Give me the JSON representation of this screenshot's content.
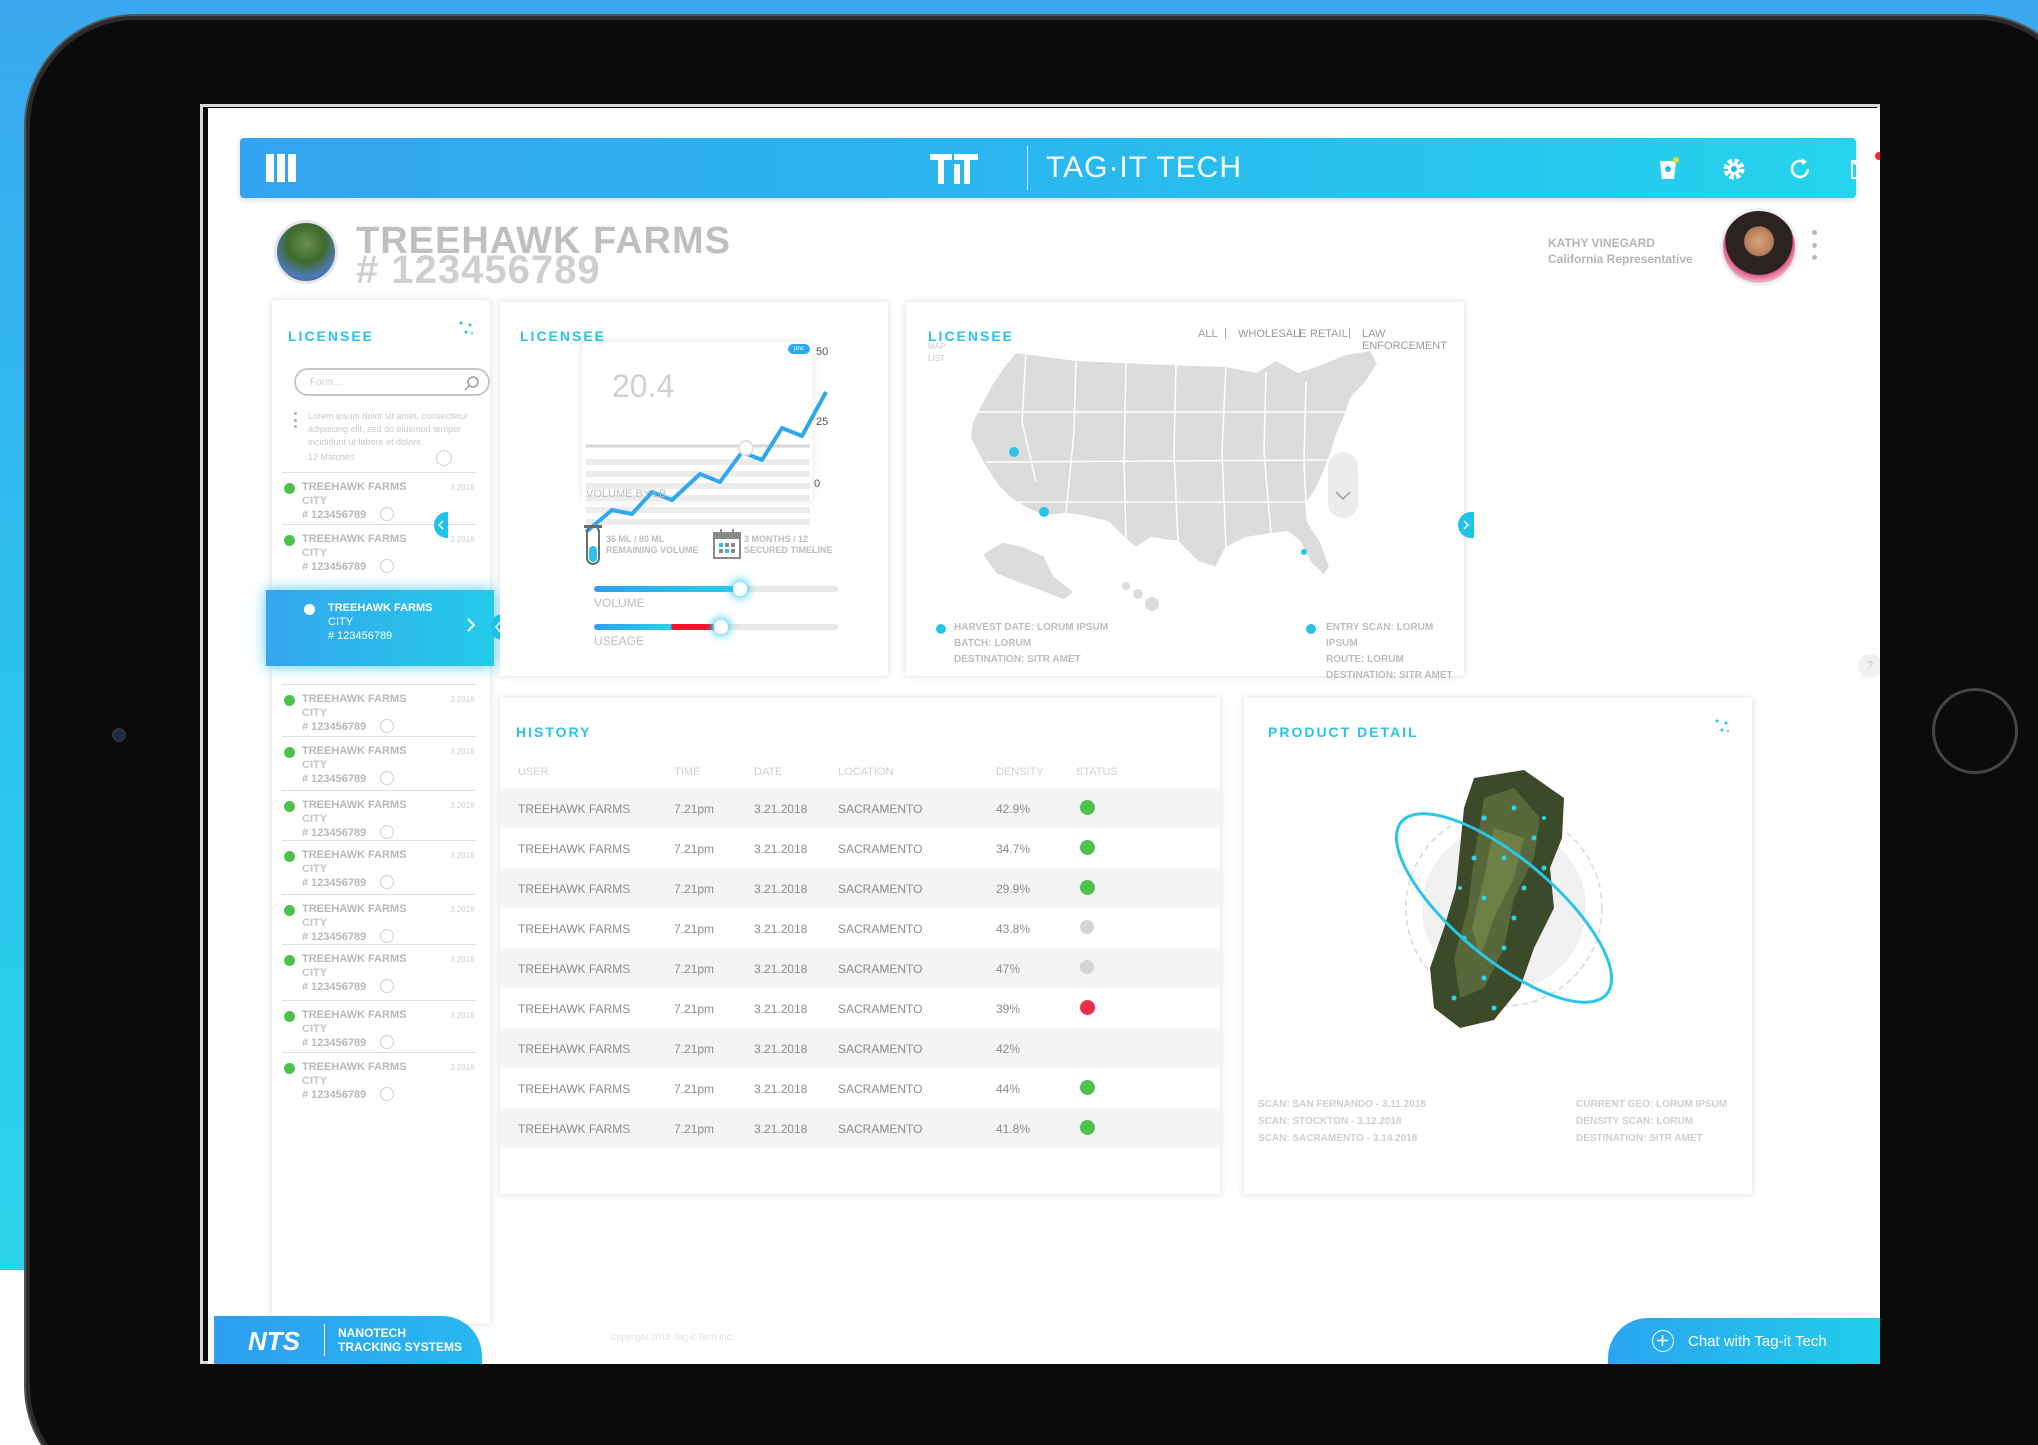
{
  "brand": {
    "name": "TAG·IT TECH"
  },
  "header": {
    "farm_name": "TREEHAWK FARMS",
    "farm_id": "# 123456789",
    "user_name": "KATHY VINEGARD",
    "user_role": "California Representative"
  },
  "licensee_list": {
    "title": "LICENSEE",
    "search_placeholder": "Form...",
    "description": "Lorem ipsum dolor sit amet, consectetur adipiscing elit, sed do eiusmod tempor incididunt ut labore et dolore.",
    "matches": "12 Matches",
    "items": [
      {
        "name": "TREEHAWK FARMS",
        "city": "CITY",
        "id": "# 123456789",
        "date": "3.2018"
      },
      {
        "name": "TREEHAWK FARMS",
        "city": "CITY",
        "id": "# 123456789",
        "date": "3.2018"
      },
      {
        "name": "TREEHAWK FARMS",
        "city": "CITY",
        "id": "# 123456789",
        "date": "3.2018"
      },
      {
        "name": "TREEHAWK FARMS",
        "city": "CITY",
        "id": "# 123456789",
        "date": "3.2018"
      },
      {
        "name": "TREEHAWK FARMS",
        "city": "CITY",
        "id": "# 123456789",
        "date": "3.2018"
      },
      {
        "name": "TREEHAWK FARMS",
        "city": "CITY",
        "id": "# 123456789",
        "date": "3.2018"
      },
      {
        "name": "TREEHAWK FARMS",
        "city": "CITY",
        "id": "# 123456789",
        "date": "3.2018"
      },
      {
        "name": "TREEHAWK FARMS",
        "city": "CITY",
        "id": "# 123456789",
        "date": "3.2018"
      },
      {
        "name": "TREEHAWK FARMS",
        "city": "CITY",
        "id": "# 123456789",
        "date": "3.2018"
      },
      {
        "name": "TREEHAWK FARMS",
        "city": "CITY",
        "id": "# 123456789",
        "date": "3.2018"
      },
      {
        "name": "TREEHAWK FARMS",
        "city": "CITY",
        "id": "# 123456789",
        "date": "3.2018"
      }
    ],
    "selected": {
      "name": "TREEHAWK FARMS",
      "city": "CITY",
      "id": "# 123456789"
    }
  },
  "stats": {
    "title": "LICENSEE",
    "big_value": "20.4",
    "chart_badge": "pnc",
    "y_ticks": [
      "50",
      "25",
      "0"
    ],
    "chart_label": "VOLUME BY LB.",
    "remaining": "36 ML / 80 ML",
    "remaining_label": "REMAINING VOLUME",
    "timeline": "3 MONTHS / 12",
    "timeline_label": "SECURED TIMELINE",
    "volume_label": "VOLUME",
    "usage_label": "USEAGE",
    "volume_level": 0.6,
    "usage_level": 0.52
  },
  "map": {
    "title": "LICENSEE",
    "sub1": "MAP",
    "sub2": "LIST",
    "filters": [
      "ALL",
      "WHOLESALE",
      "RETAIL",
      "LAW ENFORCEMENT"
    ],
    "legend_left": [
      "HARVEST DATE: LORUM IPSUM",
      "BATCH: LORUM",
      "DESTINATION: SITR AMET"
    ],
    "legend_right": [
      "ENTRY SCAN: LORUM IPSUM",
      "ROUTE: LORUM",
      "DESTINATION: SITR AMET"
    ]
  },
  "history": {
    "title": "HISTORY",
    "columns": [
      "USER",
      "TIME",
      "DATE",
      "LOCATION",
      "DENSITY",
      "STATUS"
    ],
    "rows": [
      {
        "user": "TREEHAWK FARMS",
        "time": "7.21pm",
        "date": "3.21.2018",
        "location": "SACRAMENTO",
        "density": "42.9%",
        "status": "ok"
      },
      {
        "user": "TREEHAWK FARMS",
        "time": "7.21pm",
        "date": "3.21.2018",
        "location": "SACRAMENTO",
        "density": "34.7%",
        "status": "ok"
      },
      {
        "user": "TREEHAWK FARMS",
        "time": "7.21pm",
        "date": "3.21.2018",
        "location": "SACRAMENTO",
        "density": "29.9%",
        "status": "ok"
      },
      {
        "user": "TREEHAWK FARMS",
        "time": "7.21pm",
        "date": "3.21.2018",
        "location": "SACRAMENTO",
        "density": "43.8%",
        "status": "grey"
      },
      {
        "user": "TREEHAWK FARMS",
        "time": "7.21pm",
        "date": "3.21.2018",
        "location": "SACRAMENTO",
        "density": "47%",
        "status": "grey"
      },
      {
        "user": "TREEHAWK FARMS",
        "time": "7.21pm",
        "date": "3.21.2018",
        "location": "SACRAMENTO",
        "density": "39%",
        "status": "bad"
      },
      {
        "user": "TREEHAWK FARMS",
        "time": "7.21pm",
        "date": "3.21.2018",
        "location": "SACRAMENTO",
        "density": "42%",
        "status": "none"
      },
      {
        "user": "TREEHAWK FARMS",
        "time": "7.21pm",
        "date": "3.21.2018",
        "location": "SACRAMENTO",
        "density": "44%",
        "status": "ok"
      },
      {
        "user": "TREEHAWK FARMS",
        "time": "7.21pm",
        "date": "3.21.2018",
        "location": "SACRAMENTO",
        "density": "41.8%",
        "status": "ok"
      }
    ]
  },
  "product": {
    "title": "PRODUCT DETAIL",
    "scans_left": [
      "SCAN: SAN FERNANDO - 3.11.2018",
      "SCAN: STOCKTON - 3.12.2018",
      "SCAN: SACRAMENTO - 3.14.2018"
    ],
    "scans_right": [
      "CURRENT GEO: LORUM IPSUM",
      "DENSITY SCAN: LORUM",
      "DESTINATION: SITR AMET"
    ]
  },
  "footer": {
    "nts_logo": "NTS",
    "nts_line1": "NANOTECH",
    "nts_line2": "TRACKING SYSTEMS",
    "copyright": "Copyright 2018 Tag-it Tech Inc.",
    "chat": "Chat with Tag-it Tech",
    "help": "?"
  },
  "colors": {
    "accent": "#28c3e7",
    "ok": "#4cc349",
    "bad": "#e8304a",
    "bar_start": "#35a4f0",
    "bar_end": "#25d4ec"
  }
}
